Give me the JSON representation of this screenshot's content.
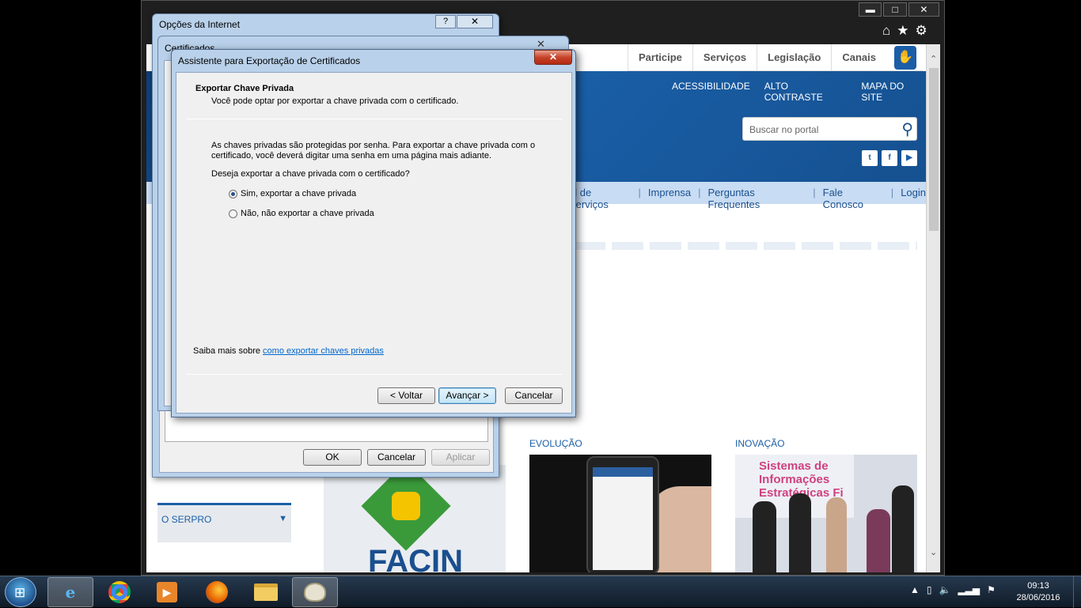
{
  "browser": {
    "window_controls": {
      "minimize": "▬",
      "maximize": "□",
      "close": "✕"
    },
    "toolbar_icons": [
      "home-icon",
      "star-icon",
      "gear-icon"
    ]
  },
  "webpage": {
    "top_nav": [
      "Participe",
      "Serviços",
      "Legislação",
      "Canais"
    ],
    "banner_links": [
      "ACESSIBILIDADE",
      "ALTO CONTRASTE",
      "MAPA DO SITE"
    ],
    "search_placeholder": "Buscar no portal",
    "social": [
      "twitter-icon",
      "facebook-icon",
      "youtube-icon"
    ],
    "sub_nav": [
      "al de Serviços",
      "Imprensa",
      "Perguntas Frequentes",
      "Fale Conosco",
      "Login"
    ],
    "sidebar_section": "O SERPRO",
    "facin_label": "FACIN",
    "section_evolucao": "EVOLUÇÃO",
    "section_inovacao": "INOVAÇÃO",
    "inovacao_slide_text": "Sistemas de\nInformações\nEstratégicas Fi"
  },
  "internet_options": {
    "title": "Opções da Internet",
    "help": "?",
    "close": "✕",
    "ok": "OK",
    "cancel": "Cancelar",
    "apply": "Aplicar"
  },
  "certificates": {
    "title": "Certificados",
    "close": "✕"
  },
  "wizard": {
    "title": "Assistente para Exportação de Certificados",
    "close": "✕",
    "heading": "Exportar Chave Privada",
    "subheading": "Você pode optar por exportar a chave privada com o certificado.",
    "info": "As chaves privadas são protegidas por senha. Para exportar a chave privada com o certificado, você deverá digitar uma senha em uma página mais adiante.",
    "question": "Deseja exportar a chave privada com o certificado?",
    "options": [
      {
        "label": "Sim, exportar a chave privada",
        "selected": true
      },
      {
        "label": "Não, não exportar a chave privada",
        "selected": false
      }
    ],
    "learn_more_prefix": "Saiba mais sobre ",
    "learn_more_link": "como exportar chaves privadas",
    "back": "< Voltar",
    "next": "Avançar >",
    "cancel": "Cancelar"
  },
  "taskbar": {
    "apps": [
      "internet-explorer-icon",
      "chrome-icon",
      "media-player-icon",
      "firefox-icon",
      "explorer-folder-icon",
      "paint-icon"
    ],
    "active_app": "paint-icon",
    "time": "09:13",
    "date": "28/06/2016"
  }
}
